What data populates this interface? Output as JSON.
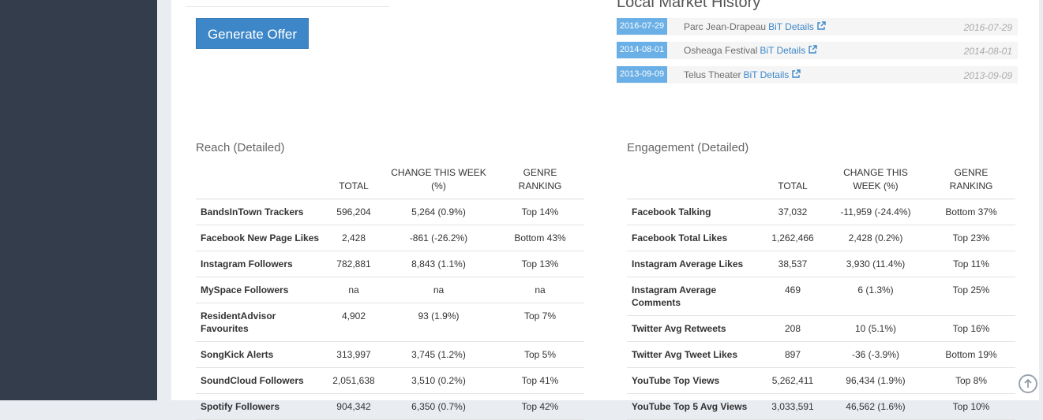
{
  "actions": {
    "generate_offer_label": "Generate Offer"
  },
  "local_market_history": {
    "title": "Local Market History",
    "items": [
      {
        "date": "2016-07-29",
        "venue": "Parc Jean-Drapeau",
        "link_label": "BiT Details",
        "right_date": "2016-07-29"
      },
      {
        "date": "2014-08-01",
        "venue": "Osheaga Festival",
        "link_label": "BiT Details",
        "right_date": "2014-08-01"
      },
      {
        "date": "2013-09-09",
        "venue": "Telus Theater",
        "link_label": "BiT Details",
        "right_date": "2013-09-09"
      }
    ]
  },
  "reach": {
    "title": "Reach (Detailed)",
    "headers": {
      "total": "TOTAL",
      "change": "CHANGE THIS WEEK (%)",
      "ranking": "GENRE RANKING"
    },
    "rows": [
      {
        "name": "BandsInTown Trackers",
        "total": "596,204",
        "change": "5,264 (0.9%)",
        "ranking": "Top 14%",
        "trend": "pos"
      },
      {
        "name": "Facebook New Page Likes",
        "total": "2,428",
        "change": "-861 (-26.2%)",
        "ranking": "Bottom 43%",
        "trend": "neg"
      },
      {
        "name": "Instagram Followers",
        "total": "782,881",
        "change": "8,843 (1.1%)",
        "ranking": "Top 13%",
        "trend": "pos"
      },
      {
        "name": "MySpace Followers",
        "total": "na",
        "change": "na",
        "ranking": "na",
        "trend": "neu"
      },
      {
        "name": "ResidentAdvisor Favourites",
        "total": "4,902",
        "change": "93 (1.9%)",
        "ranking": "Top 7%",
        "trend": "pos"
      },
      {
        "name": "SongKick Alerts",
        "total": "313,997",
        "change": "3,745 (1.2%)",
        "ranking": "Top 5%",
        "trend": "pos"
      },
      {
        "name": "SoundCloud Followers",
        "total": "2,051,638",
        "change": "3,510 (0.2%)",
        "ranking": "Top 41%",
        "trend": "pos"
      },
      {
        "name": "Spotify Followers",
        "total": "904,342",
        "change": "6,350 (0.7%)",
        "ranking": "Top 42%",
        "trend": "pos"
      }
    ]
  },
  "engagement": {
    "title": "Engagement (Detailed)",
    "headers": {
      "total": "TOTAL",
      "change": "CHANGE THIS WEEK (%)",
      "ranking": "GENRE RANKING"
    },
    "rows": [
      {
        "name": "Facebook Talking",
        "total": "37,032",
        "change": "-11,959 (-24.4%)",
        "ranking": "Bottom 37%",
        "trend": "neg"
      },
      {
        "name": "Facebook Total Likes",
        "total": "1,262,466",
        "change": "2,428 (0.2%)",
        "ranking": "Top 23%",
        "trend": "pos"
      },
      {
        "name": "Instagram Average Likes",
        "total": "38,537",
        "change": "3,930 (11.4%)",
        "ranking": "Top 11%",
        "trend": "pos"
      },
      {
        "name": "Instagram Average Comments",
        "total": "469",
        "change": "6 (1.3%)",
        "ranking": "Top 25%",
        "trend": "pos"
      },
      {
        "name": "Twitter Avg Retweets",
        "total": "208",
        "change": "10 (5.1%)",
        "ranking": "Top 16%",
        "trend": "pos"
      },
      {
        "name": "Twitter Avg Tweet Likes",
        "total": "897",
        "change": "-36 (-3.9%)",
        "ranking": "Bottom 19%",
        "trend": "neg"
      },
      {
        "name": "YouTube Top Views",
        "total": "5,262,411",
        "change": "96,434 (1.9%)",
        "ranking": "Top 8%",
        "trend": "pos"
      },
      {
        "name": "YouTube Top 5 Avg Views",
        "total": "3,033,591",
        "change": "46,562 (1.6%)",
        "ranking": "Top 10%",
        "trend": "pos"
      }
    ]
  },
  "colors": {
    "accent": "#3d87c9",
    "positive": "#2ec32e",
    "negative": "#e23b3b",
    "sidebar": "#333d4b"
  },
  "icons": {
    "external_link": "external-link-icon",
    "scroll_top": "arrow-up-circle-icon"
  }
}
